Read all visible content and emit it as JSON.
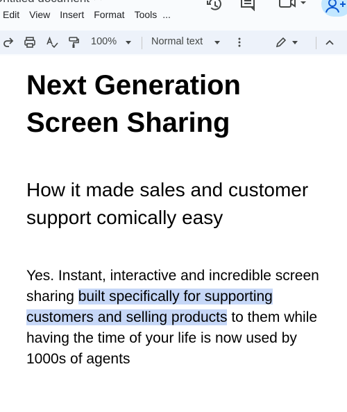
{
  "window": {
    "doc_title": "Untitled document"
  },
  "menubar": {
    "items": [
      "Edit",
      "View",
      "Insert",
      "Format",
      "Tools",
      "..."
    ]
  },
  "toolbar": {
    "zoom": "100%",
    "paragraph_style": "Normal text"
  },
  "document": {
    "title": "Next Generation Screen Sharing",
    "subtitle": "How it made sales and customer support comically easy",
    "body_before": "Yes. Instant, interactive and incredible screen sharing ",
    "body_highlight": "built specifically for supporting customers and selling products",
    "body_after": " to them while having the time of your life is now used by 1000s of agents"
  },
  "colors": {
    "chrome_bg": "#f9fbfd",
    "toolbar_bg": "#edf2fa",
    "selection": "#c6d7f7",
    "share_button": "#c2e7ff"
  }
}
